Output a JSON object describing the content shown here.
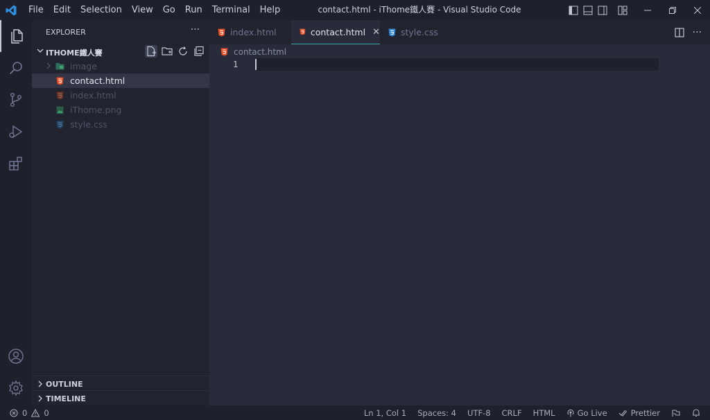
{
  "colors": {
    "accent": "#3fa6a1",
    "vscode_blue": "#2f8fe0",
    "html_icon": "#e44d26",
    "css_icon": "#2f86d6",
    "image_icon": "#3fa16e"
  },
  "menu": [
    "File",
    "Edit",
    "Selection",
    "View",
    "Go",
    "Run",
    "Terminal",
    "Help"
  ],
  "window_title": "contact.html - iThome鐵人賽 - Visual Studio Code",
  "explorer": {
    "title": "EXPLORER",
    "more": "···",
    "folder": "ITHOME鐵人賽",
    "items": [
      {
        "label": "image",
        "icon": "folder-icon"
      },
      {
        "label": "contact.html",
        "icon": "html-icon"
      },
      {
        "label": "index.html",
        "icon": "html-icon"
      },
      {
        "label": "iThome.png",
        "icon": "image-icon"
      },
      {
        "label": "style.css",
        "icon": "css-icon"
      }
    ],
    "outline": "OUTLINE",
    "timeline": "TIMELINE"
  },
  "tabs": [
    {
      "label": "index.html",
      "icon": "html-icon"
    },
    {
      "label": "contact.html",
      "icon": "html-icon",
      "close": "✕"
    },
    {
      "label": "style.css",
      "icon": "css-icon"
    }
  ],
  "tab_more": "···",
  "breadcrumb": "contact.html",
  "editor": {
    "line_number": "1"
  },
  "status": {
    "errors": "0",
    "warnings": "0",
    "position": "Ln 1, Col 1",
    "spaces": "Spaces: 4",
    "encoding": "UTF-8",
    "eol": "CRLF",
    "language": "HTML",
    "golive": "Go Live",
    "prettier": "Prettier"
  }
}
